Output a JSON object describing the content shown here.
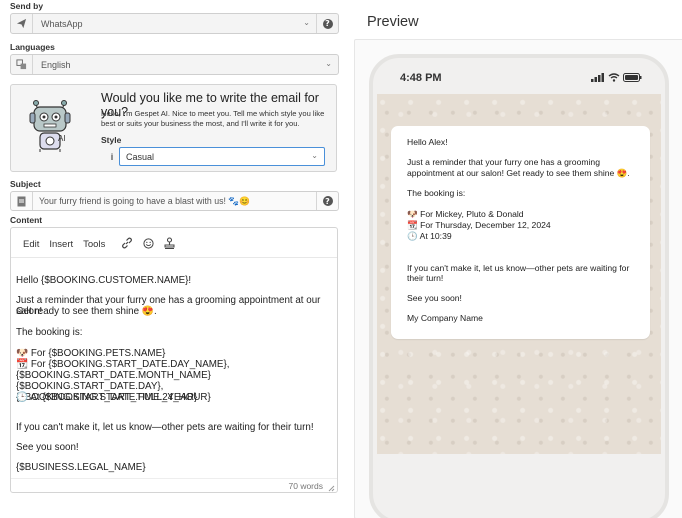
{
  "send_by": {
    "label": "Send by",
    "value": "WhatsApp"
  },
  "languages": {
    "label": "Languages",
    "value": "English"
  },
  "ai": {
    "title": "Would you like me to write the email for you?",
    "description": "Hello, I'm Gespet AI. Nice to meet you. Tell me which style you like best or suits your business the most, and I'll write it for you.",
    "style_label": "Style",
    "style_value": "Casual",
    "robot_badge": "AI"
  },
  "subject": {
    "label": "Subject",
    "value": "Your furry friend is going to have a blast with us! 🐾😊"
  },
  "content": {
    "label": "Content",
    "menu": [
      "Edit",
      "Insert",
      "Tools"
    ],
    "lines": [
      "Hello {$BOOKING.CUSTOMER.NAME}!",
      "Just a reminder that your furry one has a grooming appointment at our salon!",
      "Get ready to see them shine 😍.",
      "The booking is:",
      "🐶 For {$BOOKING.PETS.NAME}",
      "📆 For {$BOOKING.START_DATE.DAY_NAME},",
      "{$BOOKING.START_DATE.MONTH_NAME}",
      "{$BOOKING.START_DATE.DAY}, {$BOOKING.START_DATE.FULL_YEAR}",
      "🕒 At {$BOOKING.START_TIME.24_HOUR}",
      "If you can't make it, let us know—other pets are waiting for their turn!",
      "See you soon!",
      "{$BUSINESS.LEGAL_NAME}"
    ],
    "word_count": "70 words"
  },
  "preview": {
    "title": "Preview",
    "status_time": "4:48 PM",
    "message_lines": [
      "Hello Alex!",
      "Just a reminder that your furry one has a grooming",
      "appointment at our salon! Get ready to see them shine 😍.",
      "The booking is:",
      "🐶 For Mickey, Pluto & Donald",
      "📆 For Thursday, December 12, 2024",
      "🕒 At 10:39",
      "If you can't make it, let us know—other pets are waiting for",
      "their turn!",
      "See you soon!",
      "My Company Name"
    ]
  },
  "icons": {
    "send": "paper-plane-icon",
    "language": "translate-icon",
    "help": "help-icon",
    "info": "info-icon",
    "document": "document-icon",
    "link": "link-icon",
    "emoji": "emoji-icon",
    "stamp": "stamp-icon",
    "resize": "resize-handle-icon"
  },
  "colors": {
    "focus_border": "#4a90d9",
    "wallpaper": "#e6ded4"
  }
}
